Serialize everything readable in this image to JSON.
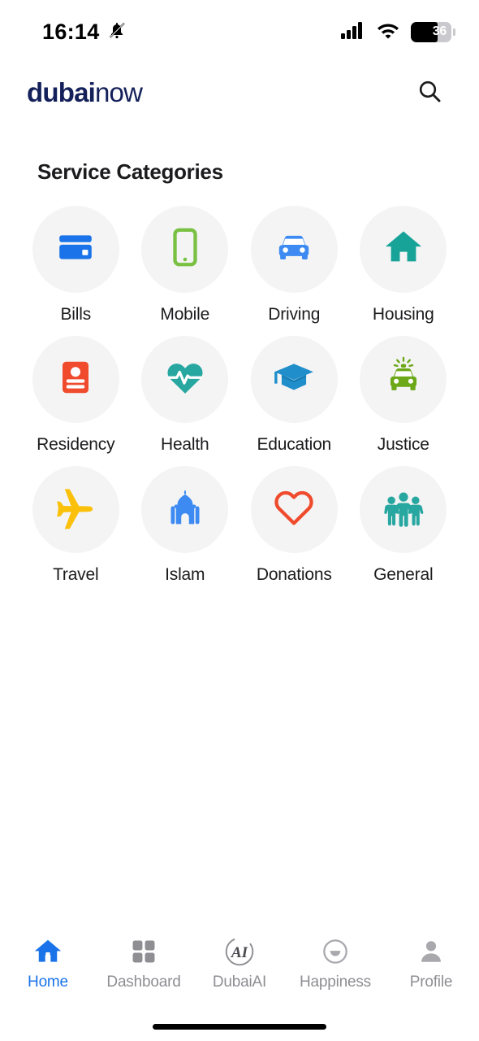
{
  "status_bar": {
    "time": "16:14",
    "mute_icon": "bell-slash-icon",
    "signal_icon": "cellular-signal-icon",
    "wifi_icon": "wifi-icon",
    "battery_percent": "36"
  },
  "header": {
    "logo_bold": "dubai",
    "logo_light": "now",
    "logo_color": "#14205a",
    "search_icon": "search-icon"
  },
  "main": {
    "section_title": "Service Categories",
    "categories": [
      {
        "label": "Bills",
        "icon": "credit-card-icon",
        "color": "#1a73e8"
      },
      {
        "label": "Mobile",
        "icon": "smartphone-icon",
        "color": "#7ac143"
      },
      {
        "label": "Driving",
        "icon": "car-icon",
        "color": "#3d8bf2"
      },
      {
        "label": "Housing",
        "icon": "house-icon",
        "color": "#17a398"
      },
      {
        "label": "Residency",
        "icon": "id-card-icon",
        "color": "#ef4b2c"
      },
      {
        "label": "Health",
        "icon": "heart-pulse-icon",
        "color": "#27a7a0"
      },
      {
        "label": "Education",
        "icon": "graduation-cap-icon",
        "color": "#1f8ecb"
      },
      {
        "label": "Justice",
        "icon": "police-car-icon",
        "color": "#6da818"
      },
      {
        "label": "Travel",
        "icon": "airplane-icon",
        "color": "#fbc10a"
      },
      {
        "label": "Islam",
        "icon": "mosque-icon",
        "color": "#3d8bf2"
      },
      {
        "label": "Donations",
        "icon": "heart-outline-icon",
        "color": "#ef4b2c"
      },
      {
        "label": "General",
        "icon": "people-group-icon",
        "color": "#27a7a0"
      }
    ]
  },
  "tabbar": {
    "active_color": "#1a73e8",
    "inactive_color": "#8e8e93",
    "items": [
      {
        "label": "Home",
        "icon": "home-icon",
        "active": true
      },
      {
        "label": "Dashboard",
        "icon": "grid-icon",
        "active": false
      },
      {
        "label": "DubaiAI",
        "icon": "ai-circle-icon",
        "active": false
      },
      {
        "label": "Happiness",
        "icon": "smiley-icon",
        "active": false
      },
      {
        "label": "Profile",
        "icon": "person-icon",
        "active": false
      }
    ]
  }
}
